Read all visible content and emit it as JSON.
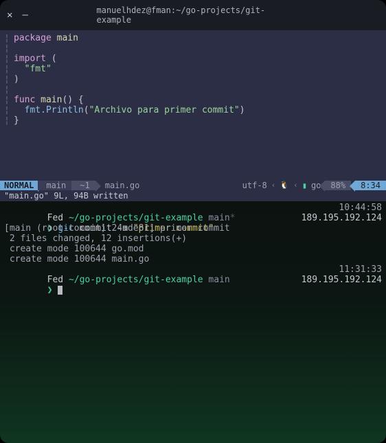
{
  "window": {
    "title": "manuelhdez@fman:~/go-projects/git-example"
  },
  "editor": {
    "code": {
      "l1_kw": "package",
      "l1_ident": " main",
      "l3_kw": "import",
      "l3_paren": " (",
      "l4_indent": "  ",
      "l4_str": "\"fmt\"",
      "l5_paren": ")",
      "l7_kw": "func",
      "l7_ident": " main",
      "l7_rest": "() {",
      "l8_indent": "  ",
      "l8_call": "fmt.Println",
      "l8_paren_open": "(",
      "l8_str": "\"Archivo para primer commit\"",
      "l8_paren_close": ")",
      "l9_brace": "}"
    }
  },
  "statusline": {
    "mode": "NORMAL",
    "branch_icon": "",
    "branch": " main",
    "commits": "~1",
    "filename": "main.go",
    "encoding": "utf-8",
    "lang": "go",
    "percent": "88%",
    "time": "8:34"
  },
  "msgline": "\"main.go\" 9L, 94B written",
  "terminal": {
    "l1_user": "Fed ",
    "l1_path": "~/go-projects/git-example",
    "l1_branch": " main",
    "l1_star": "*",
    "l1_time": "10:44:58",
    "l2_prompt": "❯ ",
    "l2_git": "git",
    "l2_cmd": " commit -m ",
    "l2_msg": "\"primer commit\"",
    "l2_ip": "189.195.192.124",
    "l3": "[main (root-commit) 24ade81] primer commit",
    "l4": " 2 files changed, 12 insertions(+)",
    "l5": " create mode 100644 go.mod",
    "l6": " create mode 100644 main.go",
    "l7_user": "Fed ",
    "l7_path": "~/go-projects/git-example",
    "l7_branch": " main",
    "l7_time": "11:31:33",
    "l8_prompt": "❯",
    "l8_ip": "189.195.192.124"
  }
}
